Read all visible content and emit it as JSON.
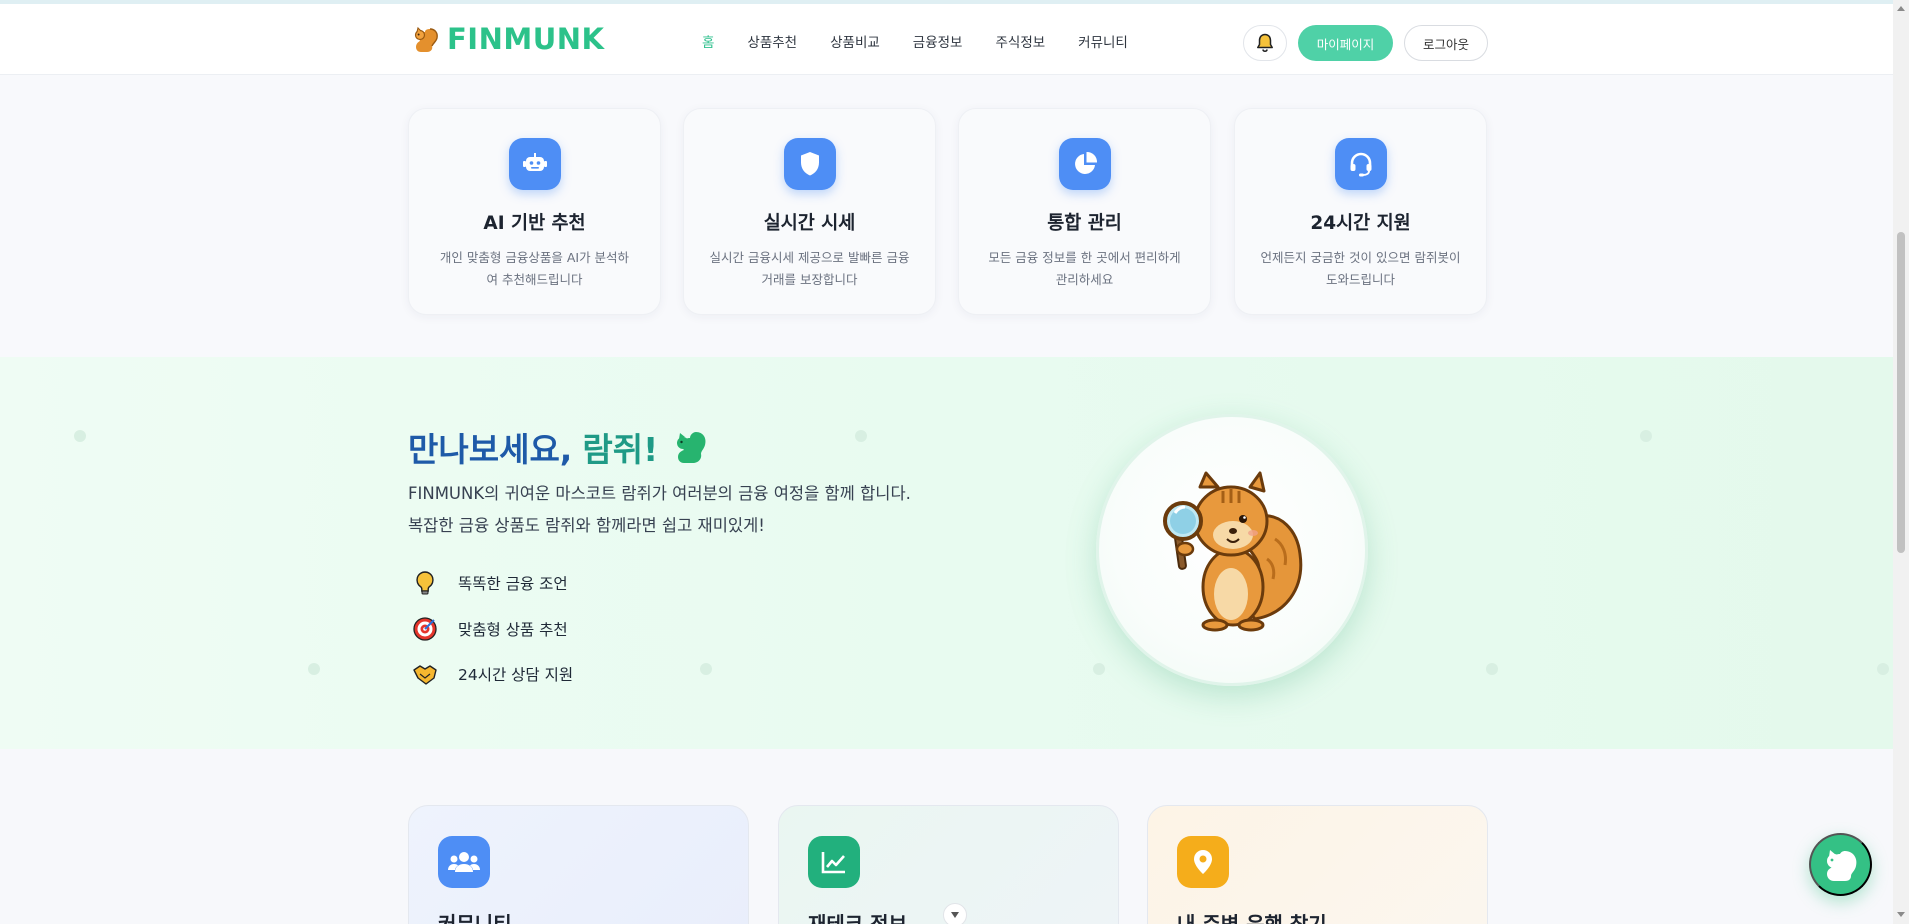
{
  "header": {
    "logo_text": "FINMUNK",
    "nav": [
      {
        "label": "홈",
        "active": true
      },
      {
        "label": "상품추천"
      },
      {
        "label": "상품비교"
      },
      {
        "label": "금융정보"
      },
      {
        "label": "주식정보"
      },
      {
        "label": "커뮤니티"
      }
    ],
    "bell_icon": "bell-icon",
    "mypage_label": "마이페이지",
    "logout_label": "로그아웃"
  },
  "features": [
    {
      "icon": "robot-icon",
      "title": "AI 기반 추천",
      "desc": "개인 맞춤형 금융상품을 AI가 분석하여 추천해드립니다"
    },
    {
      "icon": "shield-icon",
      "title": "실시간 시세",
      "desc": "실시간 금융시세 제공으로 발빠른 금융거래를 보장합니다"
    },
    {
      "icon": "pie-chart-icon",
      "title": "통합 관리",
      "desc": "모든 금융 정보를 한 곳에서 편리하게 관리하세요"
    },
    {
      "icon": "headset-icon",
      "title": "24시간 지원",
      "desc": "언제든지 궁금한 것이 있으면 람쥐봇이 도와드립니다"
    }
  ],
  "mascot": {
    "title_main": "만나보세요,",
    "title_highlight": "람쥐!",
    "description": "FINMUNK의 귀여운 마스코트 람쥐가 여러분의 금융 여정을 함께 합니다. 복잡한 금융 상품도 람쥐와 함께라면 쉽고 재미있게!",
    "items": [
      {
        "icon": "lightbulb-icon",
        "label": "똑똑한 금융 조언"
      },
      {
        "icon": "target-icon",
        "label": "맞춤형 상품 추천"
      },
      {
        "icon": "handshake-icon",
        "label": "24시간 상담 지원"
      }
    ]
  },
  "bottom_cards": [
    {
      "icon": "users-icon",
      "title": "커뮤니티",
      "color": "#4e8ef5"
    },
    {
      "icon": "chart-line-icon",
      "title": "재테크 정보",
      "color": "#22b07d"
    },
    {
      "icon": "location-pin-icon",
      "title": "내 주변 은행 찾기",
      "color": "#f5ad1b"
    }
  ],
  "colors": {
    "brand": "#2cc28a",
    "accent_blue": "#4e8ef5",
    "title_blue": "#1e5aa8",
    "title_teal": "#1f9a86"
  }
}
